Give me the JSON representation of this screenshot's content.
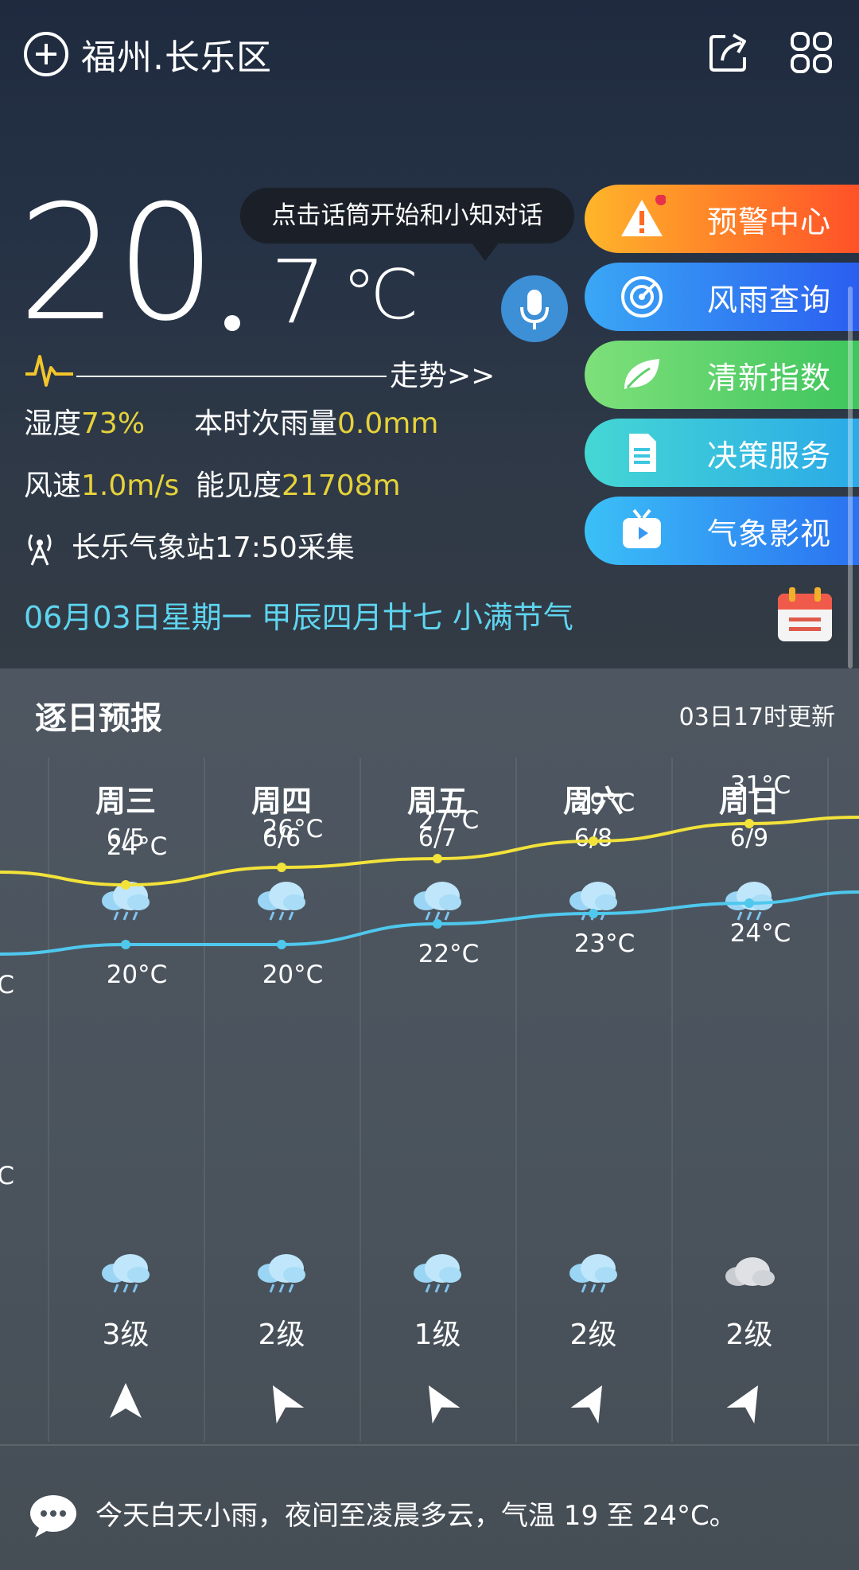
{
  "header": {
    "city": "福州.长乐区"
  },
  "current": {
    "temp_int": "20",
    "temp_dec": "7",
    "unit": "℃",
    "voice_hint": "点击话筒开始和小知对话",
    "trend_label": "走势>>",
    "humidity_label": "湿度",
    "humidity_value": "73%",
    "rain_label": "本时次雨量",
    "rain_value": "0.0mm",
    "wind_label": "风速",
    "wind_value": "1.0m/s",
    "visibility_label": "能见度",
    "visibility_value": "21708m",
    "station": "长乐气象站17:50采集",
    "date_line": "06月03日星期一  甲辰四月廿七  小满节气"
  },
  "menu": [
    {
      "label": "预警中心",
      "color": "#ff8a1f"
    },
    {
      "label": "风雨查询",
      "color": "#2f8ef5"
    },
    {
      "label": "清新指数",
      "color": "#5fd36a"
    },
    {
      "label": "决策服务",
      "color": "#2fd0d8"
    },
    {
      "label": "气象影视",
      "color": "#3aa4f6"
    }
  ],
  "forecast": {
    "title": "逐日预报",
    "update": "03日17时更新",
    "days": [
      {
        "name": "周三",
        "date": "6/5",
        "high": "24°C",
        "low": "20°C",
        "level": "3级",
        "high_v": 24,
        "low_v": 20
      },
      {
        "name": "周四",
        "date": "6/6",
        "high": "26°C",
        "low": "20°C",
        "level": "2级",
        "high_v": 26,
        "low_v": 20
      },
      {
        "name": "周五",
        "date": "6/7",
        "high": "27°C",
        "low": "22°C",
        "level": "1级",
        "high_v": 27,
        "low_v": 22
      },
      {
        "name": "周六",
        "date": "6/8",
        "high": "29°C",
        "low": "23°C",
        "level": "2级",
        "high_v": 29,
        "low_v": 23
      },
      {
        "name": "周日",
        "date": "6/9",
        "high": "31°C",
        "low": "24°C",
        "level": "2级",
        "high_v": 31,
        "low_v": 24
      }
    ],
    "edge_left": "C",
    "summary": "今天白天小雨，夜间至凌晨多云，气温 19 至 24°C。"
  },
  "colors": {
    "high_line": "#f2e23a",
    "low_line": "#4fc8ee",
    "accent_text": "#5ed5f0",
    "highlight": "#e6d23a"
  }
}
